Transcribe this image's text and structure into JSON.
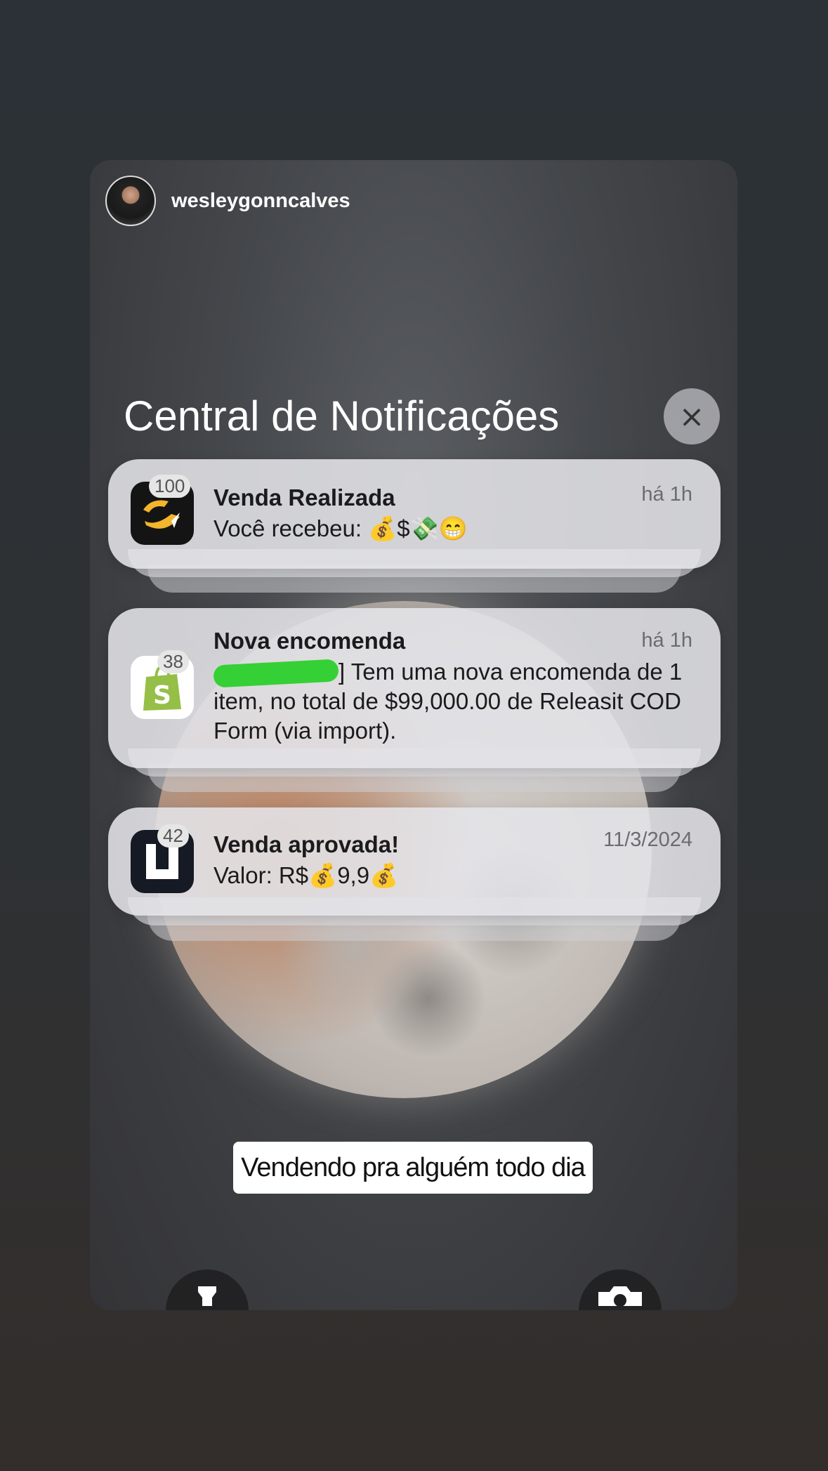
{
  "story": {
    "username": "wesleygonncalves"
  },
  "notification_center": {
    "title": "Central de Notificações",
    "close_icon": "×"
  },
  "notifications": [
    {
      "app": "sales-app",
      "badge": "100",
      "title": "Venda Realizada",
      "time": "há 1h",
      "body": "Você recebeu: 💰$💸😁"
    },
    {
      "app": "shopify",
      "badge": "38",
      "title": "Nova encomenda",
      "time": "há 1h",
      "body_suffix": "] Tem uma nova encomenda de 1 item, no total de $99,000.00 de Releasit COD Form (via import)."
    },
    {
      "app": "payment-app",
      "badge": "42",
      "title": "Venda aprovada!",
      "time": "11/3/2024",
      "body": "Valor: R$💰9,9💰"
    }
  ],
  "caption": "Vendendo pra alguém todo dia",
  "controls": {
    "left_icon": "flashlight-icon",
    "right_icon": "camera-icon"
  },
  "colors": {
    "redaction": "#35d035",
    "shopify_green": "#95bf47"
  }
}
